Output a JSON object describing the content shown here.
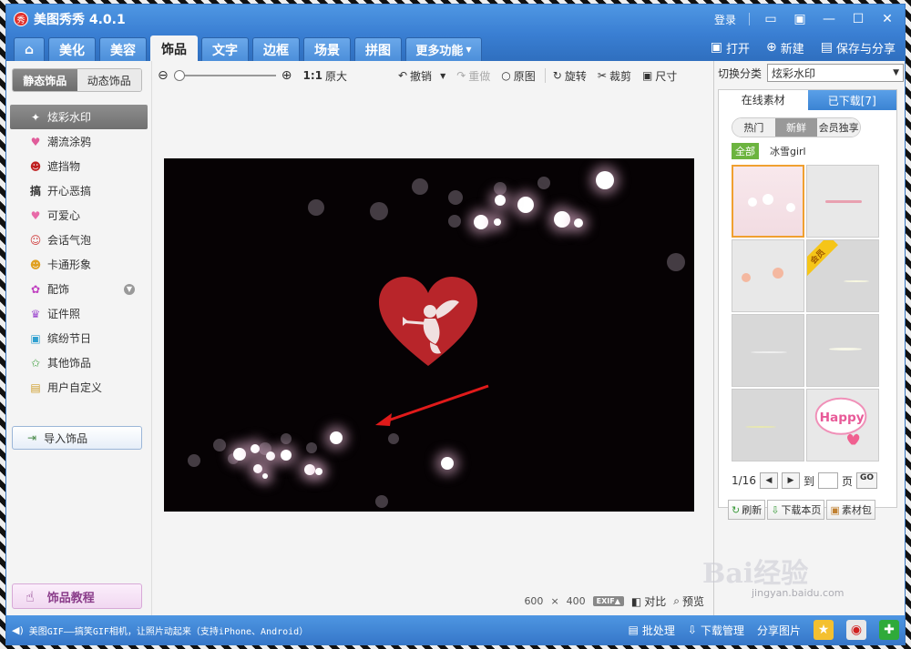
{
  "window": {
    "title": "美图秀秀 4.0.1",
    "logo_text": "秀",
    "login": "登录"
  },
  "tabs": [
    {
      "label": "⌂",
      "active": false
    },
    {
      "label": "美化",
      "active": false
    },
    {
      "label": "美容",
      "active": false
    },
    {
      "label": "饰品",
      "active": true
    },
    {
      "label": "文字",
      "active": false
    },
    {
      "label": "边框",
      "active": false
    },
    {
      "label": "场景",
      "active": false
    },
    {
      "label": "拼图",
      "active": false
    },
    {
      "label": "更多功能",
      "active": false
    }
  ],
  "file_actions": {
    "open": "打开",
    "new": "新建",
    "save": "保存与分享"
  },
  "left": {
    "subtabs": [
      "静态饰品",
      "动态饰品"
    ],
    "categories": [
      {
        "label": "炫彩水印",
        "icon": "✦",
        "active": true
      },
      {
        "label": "潮流涂鸦",
        "icon": "♥",
        "active": false
      },
      {
        "label": "遮挡物",
        "icon": "☻",
        "active": false
      },
      {
        "label": "开心恶搞",
        "icon": "搞",
        "active": false
      },
      {
        "label": "可爱心",
        "icon": "♥",
        "active": false
      },
      {
        "label": "会话气泡",
        "icon": "☺",
        "active": false
      },
      {
        "label": "卡通形象",
        "icon": "☻",
        "active": false
      },
      {
        "label": "配饰",
        "icon": "✿",
        "active": false
      },
      {
        "label": "证件照",
        "icon": "♛",
        "active": false
      },
      {
        "label": "缤纷节日",
        "icon": "▣",
        "active": false
      },
      {
        "label": "其他饰品",
        "icon": "✩",
        "active": false
      },
      {
        "label": "用户自定义",
        "icon": "▤",
        "active": false
      }
    ],
    "import_label": "导入饰品",
    "tutorial_label": "饰品教程"
  },
  "toolbar": {
    "zoom_ratio": "1:1",
    "original_size": "原大",
    "undo": "撤销",
    "redo": "重做",
    "original": "原图",
    "rotate": "旋转",
    "crop": "裁剪",
    "resize": "尺寸"
  },
  "canvas": {
    "width": "600",
    "times": "×",
    "height": "400",
    "exif": "EXIF▲",
    "compare": "对比",
    "preview": "预览"
  },
  "right": {
    "switch_label": "切换分类",
    "switch_value": "炫彩水印",
    "tab_online": "在线素材",
    "tab_downloaded": "已下载[7]",
    "pills": [
      "热门",
      "新鲜",
      "会员独享"
    ],
    "filter_all": "全部",
    "filter_author": "冰雪girl",
    "vip_ribbon": "会员",
    "page_info": "1/16",
    "to_label": "到",
    "page_label": "页",
    "go": "GO",
    "refresh": "刷新",
    "download_page": "下载本页",
    "package": "素材包"
  },
  "statusbar": {
    "message": "美图GIF——搞笑GIF相机，让照片动起来（支持iPhone、Android）",
    "batch": "批处理",
    "download_mgr": "下载管理",
    "share_pic": "分享图片"
  },
  "watermark": {
    "brand": "Bai经验",
    "url": "jingyan.baidu.com"
  },
  "colors": {
    "accent": "#3a7fd3",
    "heart": "#b8252a",
    "arrow": "#e01a1a",
    "selected_thumb": "#f0a030"
  }
}
